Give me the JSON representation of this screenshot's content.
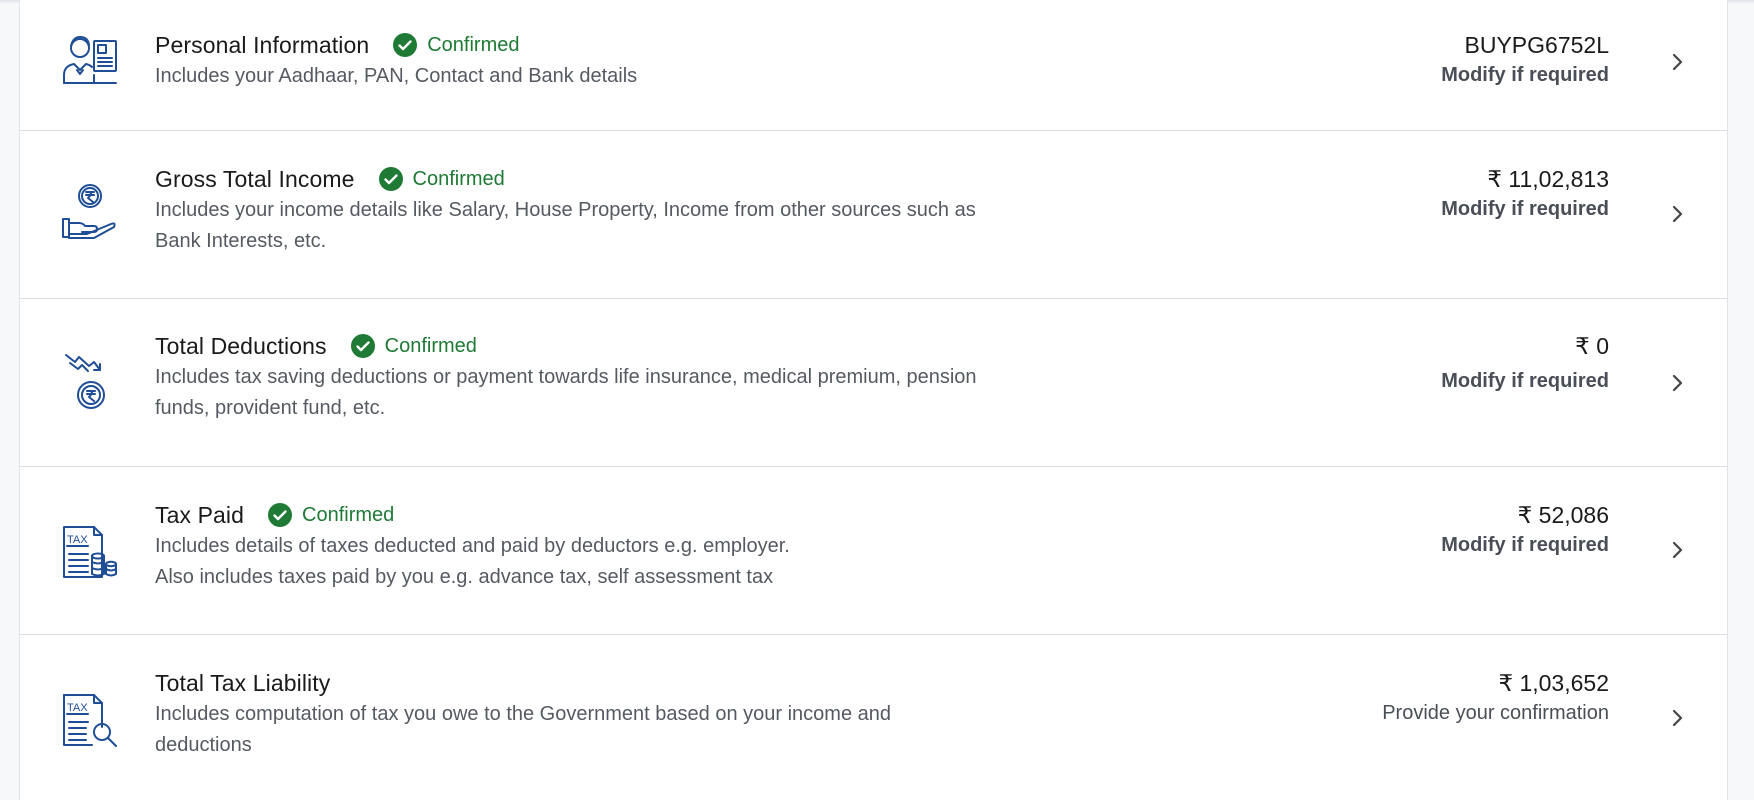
{
  "rows": [
    {
      "title": "Personal Information",
      "status": "Confirmed",
      "desc1": "Includes your Aadhaar, PAN, Contact and Bank details",
      "desc2": "",
      "value": "BUYPG6752L",
      "action": "Modify if required",
      "icon": "personal-info-icon"
    },
    {
      "title": "Gross Total Income",
      "status": "Confirmed",
      "desc1": "Includes your income details like Salary, House Property, Income from other sources such as",
      "desc2": "Bank Interests, etc.",
      "value": "₹ 11,02,813",
      "action": "Modify if required",
      "icon": "income-hand-icon"
    },
    {
      "title": "Total Deductions",
      "status": "Confirmed",
      "desc1": "Includes tax saving deductions or payment towards life insurance, medical premium, pension",
      "desc2": "funds, provident fund, etc.",
      "value": "₹ 0",
      "action": "Modify if required",
      "icon": "deduction-trend-icon"
    },
    {
      "title": "Tax Paid",
      "status": "Confirmed",
      "desc1": "Includes details of taxes deducted and paid by deductors e.g. employer.",
      "desc2": "Also includes taxes paid by you e.g. advance tax, self assessment tax",
      "value": "₹ 52,086",
      "action": "Modify if required",
      "icon": "tax-document-coins-icon"
    },
    {
      "title": "Total Tax Liability",
      "status": "",
      "desc1": "Includes computation of tax you owe to the Government based on your income and",
      "desc2": "deductions",
      "value": "₹ 1,03,652",
      "action": "Provide your confirmation",
      "icon": "tax-document-search-icon"
    }
  ],
  "colors": {
    "confirmed": "#1e7a34",
    "icon": "#1f4e96",
    "border": "#dcdfe6"
  }
}
